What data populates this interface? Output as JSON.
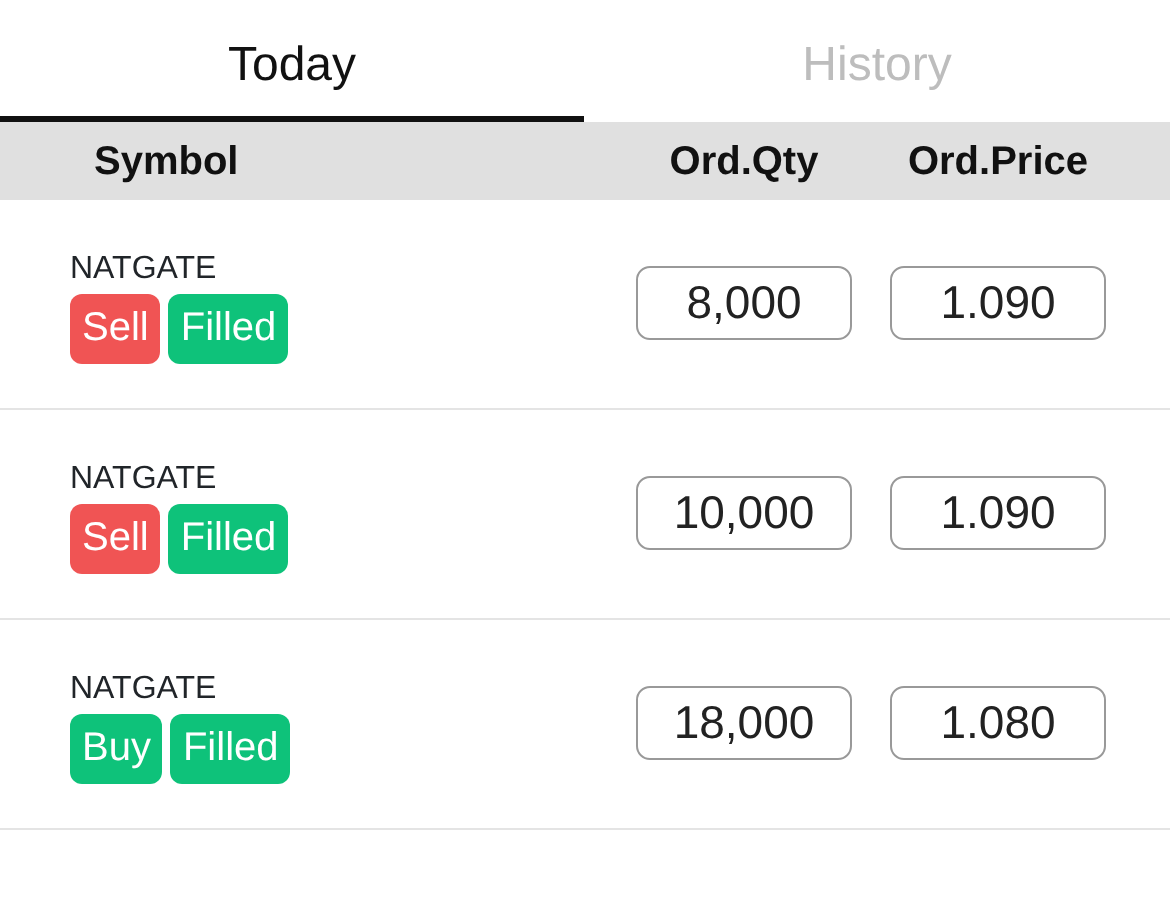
{
  "tabs": [
    {
      "label": "Today",
      "selected": true
    },
    {
      "label": "History",
      "selected": false
    }
  ],
  "table": {
    "columns": [
      "Symbol",
      "Ord.Qty",
      "Ord.Price"
    ],
    "rows": [
      {
        "symbol": "NATGATE",
        "side": {
          "text": "Sell",
          "kind": "sell"
        },
        "status": {
          "text": "Filled",
          "kind": "filled"
        },
        "qty": "8,000",
        "price": "1.090"
      },
      {
        "symbol": "NATGATE",
        "side": {
          "text": "Sell",
          "kind": "sell"
        },
        "status": {
          "text": "Filled",
          "kind": "filled"
        },
        "qty": "10,000",
        "price": "1.090"
      },
      {
        "symbol": "NATGATE",
        "side": {
          "text": "Buy",
          "kind": "buy"
        },
        "status": {
          "text": "Filled",
          "kind": "filled"
        },
        "qty": "18,000",
        "price": "1.080"
      }
    ]
  }
}
